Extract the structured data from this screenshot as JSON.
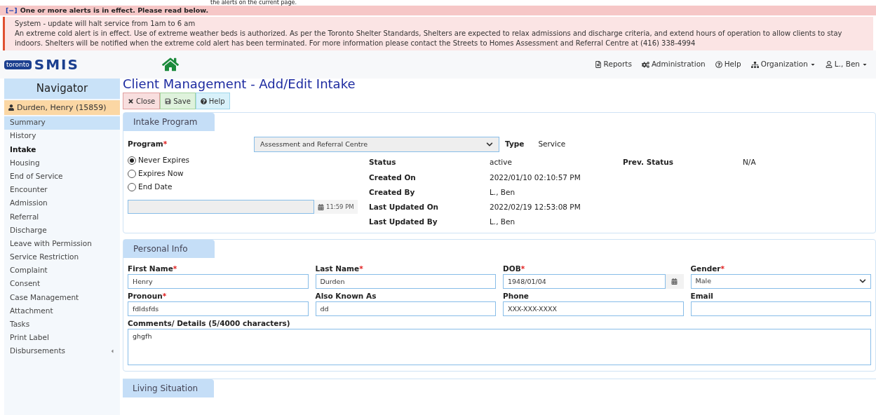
{
  "banner_text": "the alerts on the current page.",
  "alerts": {
    "toggle": "[−]",
    "expanded": true,
    "header": "One or more alerts is in effect. Please read below.",
    "messages": [
      "System - update will halt service from 1am to 6 am",
      "An extreme cold alert is in effect. Use of extreme weather beds is authorized. As per the Toronto Shelter Standards, Shelters are expected to relax admissions and discharge criteria, and extend hours of operation to allow clients to stay indoors. Shelters will be notified when the extreme cold alert has been terminated. For more information please contact the Streets to Homes Assessment and Referral Centre at (416) 338-4994"
    ]
  },
  "header": {
    "logo_small": "toronto",
    "logo": "SMIS",
    "nav": [
      {
        "label": "Reports",
        "kind": "reports",
        "dropdown": false
      },
      {
        "label": "Administration",
        "kind": "admin",
        "dropdown": false
      },
      {
        "label": "Help",
        "kind": "help",
        "dropdown": false
      },
      {
        "label": "Organization",
        "kind": "org",
        "dropdown": true
      },
      {
        "label": "L., Ben",
        "kind": "user",
        "dropdown": true
      }
    ]
  },
  "navigator": {
    "title": "Navigator",
    "client": "Durden, Henry (15859)",
    "items": [
      {
        "label": "Summary",
        "selected": true,
        "current": false,
        "submenu": false
      },
      {
        "label": "History",
        "selected": false,
        "current": false,
        "submenu": false
      },
      {
        "label": "Intake",
        "selected": false,
        "current": true,
        "submenu": false
      },
      {
        "label": "Housing",
        "selected": false,
        "current": false,
        "submenu": false
      },
      {
        "label": "End of Service",
        "selected": false,
        "current": false,
        "submenu": false
      },
      {
        "label": "Encounter",
        "selected": false,
        "current": false,
        "submenu": false
      },
      {
        "label": "Admission",
        "selected": false,
        "current": false,
        "submenu": false
      },
      {
        "label": "Referral",
        "selected": false,
        "current": false,
        "submenu": false
      },
      {
        "label": "Discharge",
        "selected": false,
        "current": false,
        "submenu": false
      },
      {
        "label": "Leave with Permission",
        "selected": false,
        "current": false,
        "submenu": false
      },
      {
        "label": "Service Restriction",
        "selected": false,
        "current": false,
        "submenu": false
      },
      {
        "label": "Complaint",
        "selected": false,
        "current": false,
        "submenu": false
      },
      {
        "label": "Consent",
        "selected": false,
        "current": false,
        "submenu": false
      },
      {
        "label": "Case Management",
        "selected": false,
        "current": false,
        "submenu": false
      },
      {
        "label": "Attachment",
        "selected": false,
        "current": false,
        "submenu": false
      },
      {
        "label": "Tasks",
        "selected": false,
        "current": false,
        "submenu": false
      },
      {
        "label": "Print Label",
        "selected": false,
        "current": false,
        "submenu": false
      },
      {
        "label": "Disbursements",
        "selected": false,
        "current": false,
        "submenu": true
      }
    ]
  },
  "page_title": "Client Management - Add/Edit Intake",
  "toolbar": [
    {
      "label": "Close",
      "kind": "close"
    },
    {
      "label": "Save",
      "kind": "save"
    },
    {
      "label": "Help",
      "kind": "help"
    }
  ],
  "intake_program": {
    "tab": "Intake Program",
    "program_label": "Program",
    "program_required_mark": "*",
    "program_value": "Assessment and Referral Centre",
    "type_label": "Type",
    "type_value": "Service",
    "expiry_options": [
      {
        "label": "Never Expires",
        "selected": true
      },
      {
        "label": "Expires Now",
        "selected": false
      },
      {
        "label": "End Date",
        "selected": false
      }
    ],
    "end_time": "11:59 PM",
    "details": [
      {
        "label": "Status",
        "value": "active"
      },
      {
        "label": "Created On",
        "value": "2022/01/10 02:10:57 PM"
      },
      {
        "label": "Created By",
        "value": "L., Ben"
      },
      {
        "label": "Last Updated On",
        "value": "2022/02/19 12:53:08 PM"
      },
      {
        "label": "Last Updated By",
        "value": "L., Ben"
      }
    ],
    "prev_status_label": "Prev. Status",
    "prev_status_value": "N/A"
  },
  "personal_info": {
    "tab": "Personal Info",
    "fields": [
      {
        "label": "First Name",
        "required_mark": "*",
        "value": "Henry",
        "kind": "text"
      },
      {
        "label": "Last Name",
        "required_mark": "*",
        "value": "Durden",
        "kind": "text"
      },
      {
        "label": "DOB",
        "required_mark": "*",
        "value": "1948/01/04",
        "kind": "date"
      },
      {
        "label": "Gender",
        "required_mark": "*",
        "value": "Male",
        "kind": "select"
      },
      {
        "label": "Pronoun",
        "required_mark": "*",
        "value": "fdldsfds",
        "kind": "text"
      },
      {
        "label": "Also Known As",
        "value": "dd",
        "kind": "text"
      },
      {
        "label": "Phone",
        "placeholder": "XXX-XXX-XXXX",
        "kind": "text"
      },
      {
        "label": "Email",
        "kind": "text"
      }
    ],
    "comments_label": "Comments/ Details (5/4000 characters)",
    "comments_value": "ghgfh"
  },
  "living_situation": {
    "tab": "Living Situation"
  }
}
